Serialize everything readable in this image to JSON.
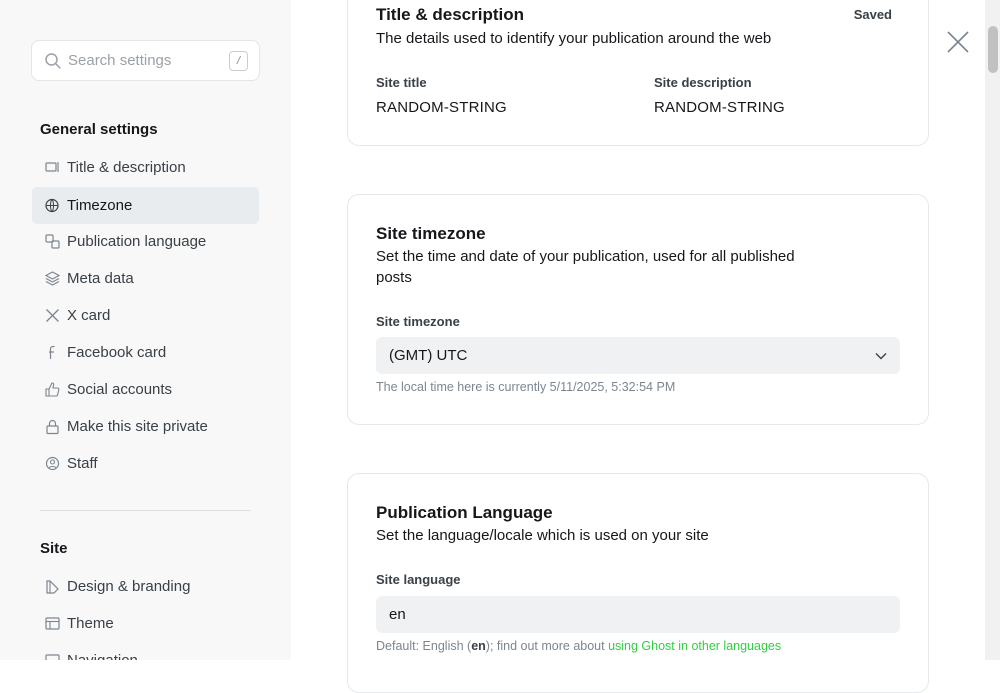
{
  "search": {
    "placeholder": "Search settings",
    "shortcut": "/"
  },
  "sidebar": {
    "general_heading": "General settings",
    "general_items": [
      {
        "label": "Title & description",
        "icon": "title-icon"
      },
      {
        "label": "Timezone",
        "icon": "globe-icon",
        "active": true
      },
      {
        "label": "Publication language",
        "icon": "translate-icon"
      },
      {
        "label": "Meta data",
        "icon": "layers-icon"
      },
      {
        "label": "X card",
        "icon": "x-logo-icon"
      },
      {
        "label": "Facebook card",
        "icon": "facebook-icon"
      },
      {
        "label": "Social accounts",
        "icon": "thumbs-up-icon"
      },
      {
        "label": "Make this site private",
        "icon": "lock-icon"
      },
      {
        "label": "Staff",
        "icon": "staff-icon"
      }
    ],
    "site_heading": "Site",
    "site_items": [
      {
        "label": "Design & branding",
        "icon": "brush-icon"
      },
      {
        "label": "Theme",
        "icon": "layout-icon"
      },
      {
        "label": "Navigation",
        "icon": "navigation-icon"
      }
    ]
  },
  "title_card": {
    "heading": "Title & description",
    "status": "Saved",
    "description": "The details used to identify your publication around the web",
    "site_title_label": "Site title",
    "site_title_value": "RANDOM-STRING",
    "site_description_label": "Site description",
    "site_description_value": "RANDOM-STRING"
  },
  "timezone_card": {
    "heading": "Site timezone",
    "description_line1": "Set the time and date of your publication, used for all published",
    "description_line2": "posts",
    "field_label": "Site timezone",
    "selected_value": "(GMT) UTC",
    "hint": "The local time here is currently 5/11/2025, 5:32:54 PM"
  },
  "language_card": {
    "heading": "Publication Language",
    "description": "Set the language/locale which is used on your site",
    "field_label": "Site language",
    "value": "en",
    "hint_prefix": "Default: English (",
    "hint_code": "en",
    "hint_middle": "); find out more about ",
    "hint_link": "using Ghost in other languages"
  },
  "colors": {
    "accent_green": "#30cf43",
    "active_bg": "#e9ecee",
    "sidebar_bg": "#f8f8f8"
  }
}
